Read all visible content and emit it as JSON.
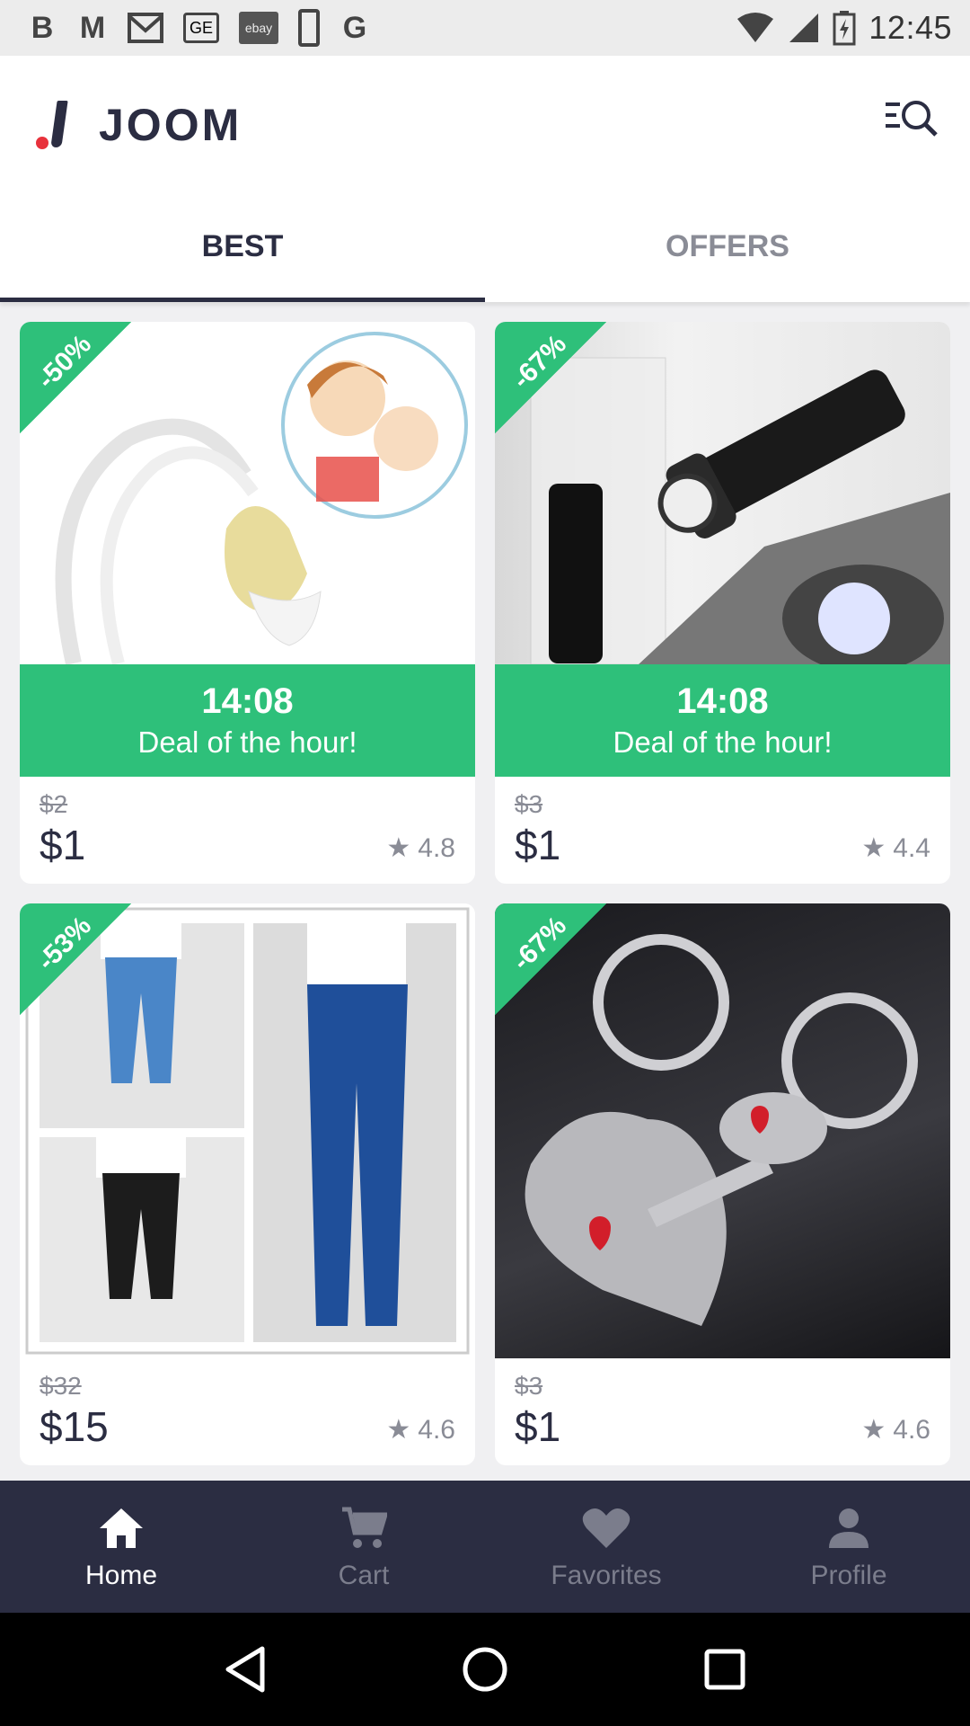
{
  "status_bar": {
    "time": "12:45",
    "icons": [
      "b-icon",
      "m-icon",
      "gmail-icon",
      "ge-icon",
      "ebay-icon",
      "phone-icon",
      "google-icon",
      "wifi-icon",
      "signal-icon",
      "battery-charging-icon"
    ],
    "ge_label": "GE",
    "ebay_label": "ebay"
  },
  "app_bar": {
    "logo_text": "JOOM",
    "search_icon": "search-icon",
    "colors": {
      "brand_dark": "#2b2d42",
      "brand_red": "#e8323c"
    }
  },
  "tabs": [
    {
      "label": "BEST",
      "active": true
    },
    {
      "label": "OFFERS",
      "active": false
    }
  ],
  "products": [
    {
      "discount": "-50%",
      "deal_time": "14:08",
      "deal_text": "Deal of the hour!",
      "old_price": "$2",
      "price": "$1",
      "rating": "4.8",
      "image": "nasal-aspirator-image"
    },
    {
      "discount": "-67%",
      "deal_time": "14:08",
      "deal_text": "Deal of the hour!",
      "old_price": "$3",
      "price": "$1",
      "rating": "4.4",
      "image": "flashlight-image"
    },
    {
      "discount": "-53%",
      "old_price": "$32",
      "price": "$15",
      "rating": "4.6",
      "image": "jeans-image"
    },
    {
      "discount": "-67%",
      "old_price": "$3",
      "price": "$1",
      "rating": "4.6",
      "image": "keychain-image"
    }
  ],
  "accent_green": "#2ec07a",
  "bottom_nav": [
    {
      "label": "Home",
      "icon": "home-icon",
      "active": true
    },
    {
      "label": "Cart",
      "icon": "cart-icon",
      "active": false
    },
    {
      "label": "Favorites",
      "icon": "heart-icon",
      "active": false
    },
    {
      "label": "Profile",
      "icon": "person-icon",
      "active": false
    }
  ],
  "system_nav": [
    "back-icon",
    "home-circle-icon",
    "recents-icon"
  ]
}
